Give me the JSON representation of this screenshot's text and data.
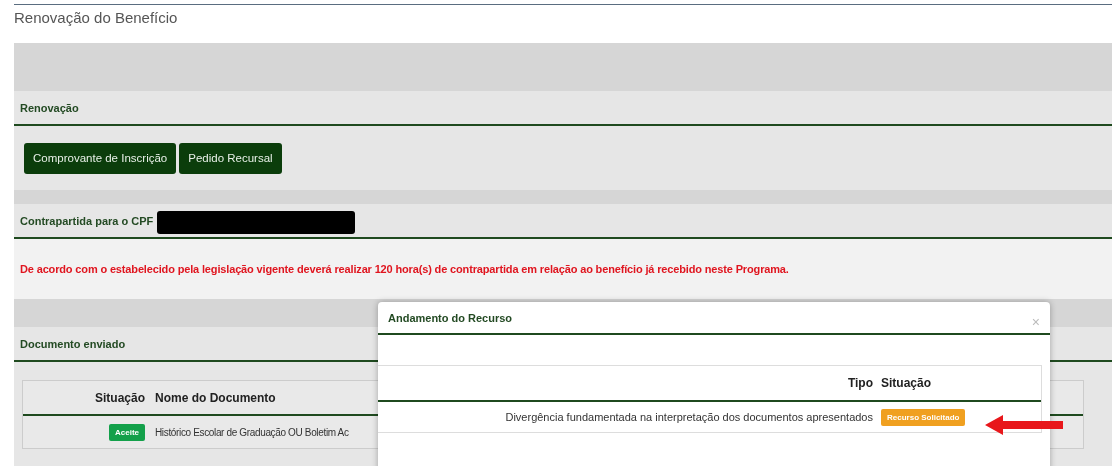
{
  "page": {
    "title": "Renovação do Benefício"
  },
  "renewal": {
    "heading": "Renovação",
    "buttons": [
      "Comprovante de Inscrição",
      "Pedido Recursal"
    ]
  },
  "counterpart": {
    "heading": "Contrapartida para o CPF",
    "notice": "De acordo com o estabelecido pela legislação vigente deverá realizar 120 hora(s) de contrapartida em relação ao benefício já recebido neste Programa."
  },
  "documents": {
    "heading": "Documento enviado",
    "columns": [
      "Situação",
      "Nome do Documento"
    ],
    "rows": [
      {
        "status": {
          "label": "Aceite",
          "kind": "accepted"
        },
        "name": "Histórico Escolar de Graduação OU Boletim Ac"
      }
    ]
  },
  "modal": {
    "title": "Andamento do Recurso",
    "close": "×",
    "columns": [
      "Tipo",
      "Situação"
    ],
    "rows": [
      {
        "type": "Divergência fundamentada na interpretação dos documentos apresentados",
        "status": {
          "label": "Recurso Solicitado",
          "kind": "requested"
        }
      }
    ]
  }
}
